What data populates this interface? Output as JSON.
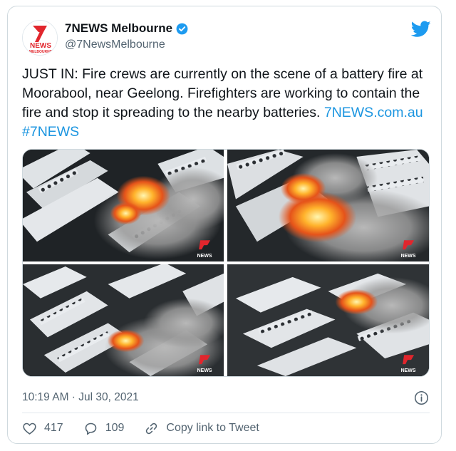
{
  "author": {
    "display_name": "7NEWS Melbourne",
    "handle": "@7NewsMelbourne",
    "verified_icon": "verified-badge-icon",
    "avatar": {
      "logo_top": "7",
      "logo_middle": "NEWS",
      "logo_bottom": "MELBOURNE"
    }
  },
  "platform_icon": "twitter-bird-icon",
  "tweet": {
    "text": "JUST IN: Fire crews are currently on the scene of a battery fire at Moorabool, near Geelong. Firefighters are working to contain the fire and stop it spreading to the nearby batteries. ",
    "link_site": "7NEWS.com.au",
    "hashtag": "#7NEWS"
  },
  "media": {
    "watermark": "NEWS",
    "images": [
      "fire-aerial-1",
      "fire-aerial-2",
      "fire-aerial-3",
      "fire-aerial-4"
    ]
  },
  "timestamp": "10:19 AM · Jul 30, 2021",
  "actions": {
    "likes": "417",
    "replies": "109",
    "copy_link": "Copy link to Tweet"
  },
  "colors": {
    "brand_blue": "#1d9bf0",
    "brand_red": "#e1262d",
    "muted": "#536471"
  }
}
